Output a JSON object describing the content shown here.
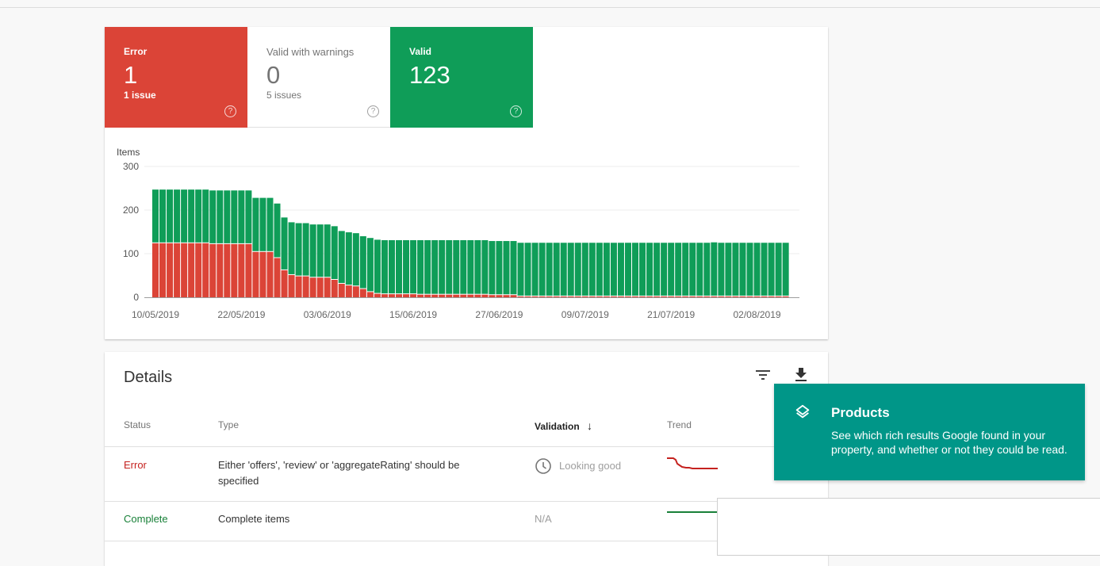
{
  "summary": {
    "tiles": [
      {
        "label": "Error",
        "value": "1",
        "sub": "1 issue",
        "color": "#db4437"
      },
      {
        "label": "Valid with warnings",
        "value": "0",
        "sub": "5 issues",
        "color": "#ffffff"
      },
      {
        "label": "Valid",
        "value": "123",
        "sub": "",
        "color": "#0f9d58"
      }
    ],
    "help_glyph": "?"
  },
  "chart_data": {
    "type": "bar",
    "stacked": true,
    "ylabel": "Items",
    "ylim": [
      0,
      300
    ],
    "yticks": [
      0,
      100,
      200,
      300
    ],
    "grid": true,
    "xtick_labels": [
      "10/05/2019",
      "22/05/2019",
      "03/06/2019",
      "15/06/2019",
      "27/06/2019",
      "09/07/2019",
      "21/07/2019",
      "02/08/2019"
    ],
    "x_start": "10/05/2019",
    "num_bars": 89,
    "series": [
      {
        "name": "Error",
        "color": "#db4437",
        "values": [
          124,
          124,
          124,
          124,
          124,
          124,
          124,
          124,
          122,
          122,
          122,
          122,
          122,
          122,
          104,
          104,
          104,
          90,
          62,
          51,
          48,
          48,
          45,
          45,
          45,
          40,
          31,
          27,
          25,
          19,
          12,
          8,
          7,
          7,
          7,
          7,
          7,
          6,
          6,
          6,
          6,
          6,
          6,
          6,
          6,
          6,
          6,
          5,
          5,
          5,
          5,
          2,
          2,
          2,
          2,
          2,
          2,
          2,
          2,
          2,
          2,
          2,
          2,
          2,
          2,
          2,
          2,
          2,
          2,
          2,
          2,
          2,
          2,
          2,
          2,
          2,
          2,
          2,
          2,
          2,
          2,
          2,
          2,
          2,
          2,
          2,
          2,
          2,
          2
        ]
      },
      {
        "name": "Valid",
        "color": "#0f9d58",
        "values": [
          123,
          123,
          123,
          123,
          123,
          123,
          123,
          123,
          123,
          123,
          123,
          123,
          123,
          123,
          124,
          124,
          124,
          125,
          121,
          121,
          122,
          122,
          122,
          122,
          122,
          123,
          121,
          122,
          122,
          121,
          124,
          124,
          124,
          124,
          124,
          124,
          124,
          125,
          125,
          125,
          125,
          125,
          125,
          125,
          125,
          125,
          125,
          124,
          124,
          124,
          124,
          123,
          123,
          123,
          123,
          123,
          123,
          123,
          123,
          123,
          123,
          123,
          123,
          123,
          123,
          123,
          123,
          123,
          123,
          123,
          123,
          123,
          123,
          123,
          123,
          123,
          123,
          123,
          124,
          123,
          123,
          123,
          123,
          123,
          123,
          123,
          123,
          123,
          123
        ]
      }
    ]
  },
  "details": {
    "title": "Details",
    "filter_icon": "filter-icon",
    "download_icon": "download-icon",
    "columns": {
      "status": "Status",
      "type": "Type",
      "validation": "Validation",
      "sort_arrow": "↓",
      "trend": "Trend"
    },
    "rows": [
      {
        "status": "Error",
        "type_line1": "Either 'offers', 'review' or 'aggregateRating' should be",
        "type_line2": "specified",
        "validation": "Looking good",
        "trend_color": "#c5221f"
      },
      {
        "status": "Complete",
        "type_line1": "Complete items",
        "type_line2": "",
        "validation": "N/A",
        "trend_color": "#188038"
      }
    ]
  },
  "tooltip": {
    "title": "Products",
    "body": "See which rich results Google found in your property, and whether or not they could be read.",
    "icon": "layers-icon",
    "color": "#009688"
  }
}
